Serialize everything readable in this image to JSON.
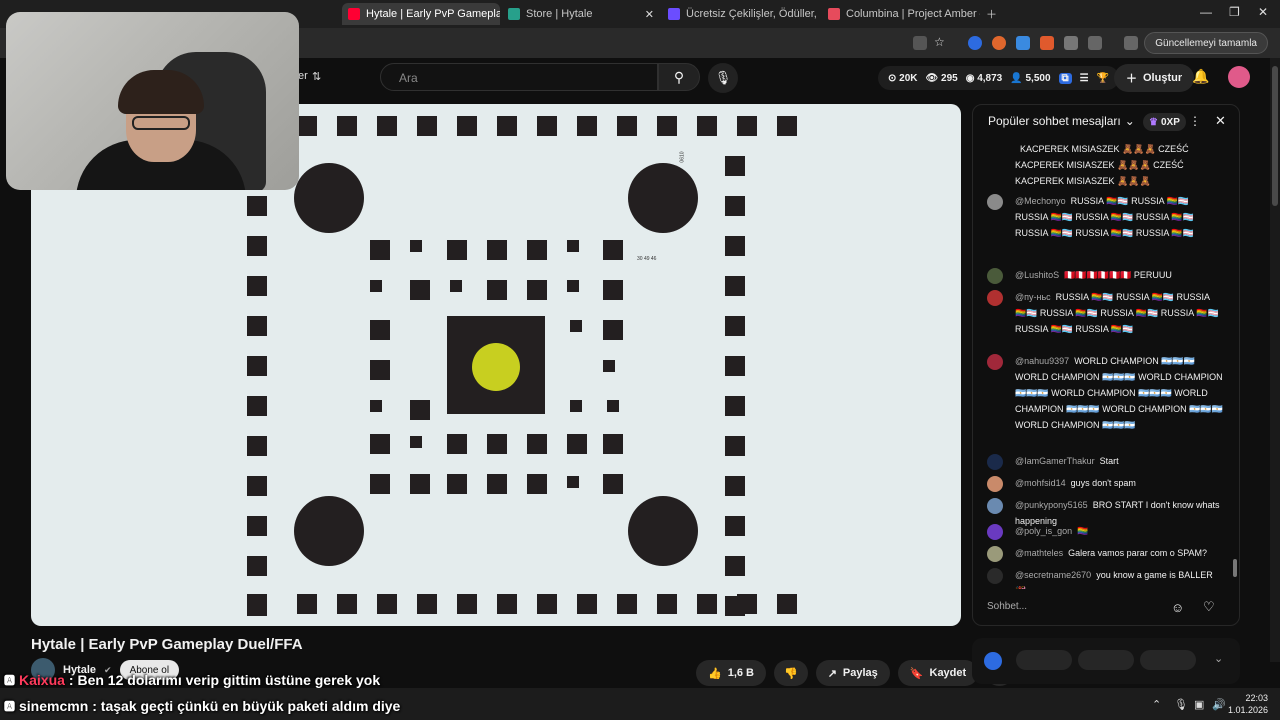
{
  "browser": {
    "tabs": [
      {
        "label": "Hytale | Early PvP Gameplay",
        "active": true,
        "color": "#ff0033"
      },
      {
        "label": "Store | Hytale",
        "active": false,
        "color": "#27a08b"
      },
      {
        "label": "Ücretsiz Çekilişler, Ödüller, Üye",
        "active": false,
        "color": "#6b4dff"
      },
      {
        "label": "Columbina | Project Amber — ",
        "active": false,
        "color": "#e64b5c"
      }
    ],
    "update_button": "Güncellemeyi tamamla"
  },
  "header": {
    "search_placeholder": "Ara",
    "partial_label": "er",
    "stats": [
      "20K",
      "295",
      "4,873",
      "5,500"
    ],
    "create_label": "Oluştur"
  },
  "video": {
    "title": "Hytale | Early PvP Gameplay Duel/FFA",
    "channel": "Hytale",
    "subscribe_label": "Abone ol",
    "likes": "1,6 B",
    "share_label": "Paylaş",
    "save_label": "Kaydet",
    "map_label_1": "30 49 46",
    "map_label_2": "0610"
  },
  "overlay": [
    {
      "name": "Kaixua",
      "text": ": Ben 12 dolarımı verip gittim üstüne gerek yok",
      "name_color": "#ff3b5c"
    },
    {
      "name": "sinemcmn",
      "text": ": taşak geçti çünkü en büyük paketi aldım diye",
      "name_color": "#ffffff"
    }
  ],
  "chat": {
    "header": "Popüler sohbet mesajları",
    "xp_badge": "0XP",
    "input_placeholder": "Sohbet...",
    "messages": [
      {
        "author": "",
        "text": "KACPEREK MISIASZEK 🧸🧸🧸 CZEŚĆ\nKACPEREK MISIASZEK 🧸🧸🧸 CZEŚĆ\nKACPEREK MISIASZEK 🧸🧸🧸",
        "avatar": "#000000"
      },
      {
        "author": "@Mechonyo",
        "text": "RUSSIA 🏳️‍🌈🏳️‍⚧️ RUSSIA 🏳️‍🌈🏳️‍⚧️ RUSSIA 🏳️‍🌈🏳️‍⚧️ RUSSIA 🏳️‍🌈🏳️‍⚧️ RUSSIA 🏳️‍🌈🏳️‍⚧️ RUSSIA 🏳️‍🌈🏳️‍⚧️ RUSSIA 🏳️‍🌈🏳️‍⚧️ RUSSIA 🏳️‍🌈🏳️‍⚧️",
        "avatar": "#8a8a8a"
      },
      {
        "author": "@LushitoS",
        "text": "🇵🇪🇵🇪🇵🇪🇵🇪🇵🇪🇵🇪 PERUUU",
        "avatar": "#4a5a3a"
      },
      {
        "author": "@пу-ньс",
        "text": "RUSSIA 🏳️‍🌈🏳️‍⚧️ RUSSIA 🏳️‍🌈🏳️‍⚧️ RUSSIA 🏳️‍🌈🏳️‍⚧️ RUSSIA 🏳️‍🌈🏳️‍⚧️ RUSSIA 🏳️‍🌈🏳️‍⚧️ RUSSIA 🏳️‍🌈🏳️‍⚧️ RUSSIA 🏳️‍🌈🏳️‍⚧️ RUSSIA 🏳️‍🌈🏳️‍⚧️",
        "avatar": "#b03030"
      },
      {
        "author": "@nahuu9397",
        "text": "WORLD CHAMPION 🇦🇷🇦🇷🇦🇷 WORLD CHAMPION 🇦🇷🇦🇷🇦🇷 WORLD CHAMPION 🇦🇷🇦🇷🇦🇷 WORLD CHAMPION 🇦🇷🇦🇷🇦🇷 WORLD CHAMPION 🇦🇷🇦🇷🇦🇷 WORLD CHAMPION 🇦🇷🇦🇷🇦🇷 WORLD CHAMPION 🇦🇷🇦🇷🇦🇷",
        "avatar": "#a0283a"
      },
      {
        "author": "@IamGamerThakur",
        "text": "Start",
        "avatar": "#1a2a4a"
      },
      {
        "author": "@mohfsid14",
        "text": "guys don't spam",
        "avatar": "#c98a6a"
      },
      {
        "author": "@punkypony5165",
        "text": "BRO START I don't know whats happening",
        "avatar": "#6a8ab0"
      },
      {
        "author": "@poly_is_gon",
        "text": "🏳️‍🌈",
        "avatar": "#6a3ac0"
      },
      {
        "author": "@mathteles",
        "text": "Galera vamos parar com o SPAM?",
        "avatar": "#9a9a7a"
      },
      {
        "author": "@secretname2670",
        "text": "you know a game is BALLER 🎉",
        "avatar": "#2a2a2a"
      }
    ]
  },
  "taskbar": {
    "time": "22:03",
    "date": "1.01.2026"
  }
}
